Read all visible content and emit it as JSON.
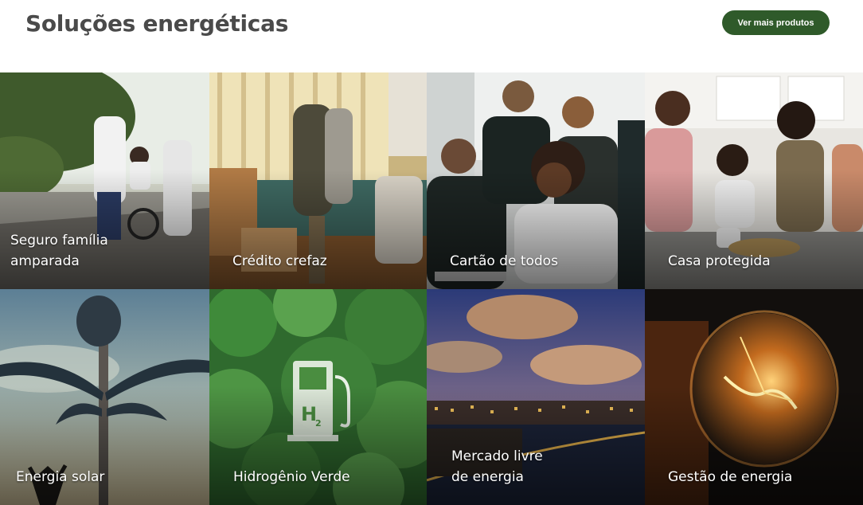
{
  "header": {
    "title": "Soluções energéticas",
    "more_button": "Ver mais produtos"
  },
  "colors": {
    "accent": "#2f5a2a"
  },
  "tiles": [
    {
      "label": "Seguro família\namparada",
      "image": "family-on-bike-photo"
    },
    {
      "label": "Crédito crefaz",
      "image": "couple-hugging-photo"
    },
    {
      "label": "Cartão de todos",
      "image": "group-with-laptop-photo"
    },
    {
      "label": "Casa protegida",
      "image": "family-cooking-photo"
    },
    {
      "label": "Energia solar",
      "image": "solar-street-lamp-photo"
    },
    {
      "label": "Hidrogênio Verde",
      "image": "h2-pump-forest-photo"
    },
    {
      "label": "Mercado livre\nde energia",
      "image": "city-night-photo"
    },
    {
      "label": "Gestão de energia",
      "image": "light-bulb-photo"
    }
  ]
}
